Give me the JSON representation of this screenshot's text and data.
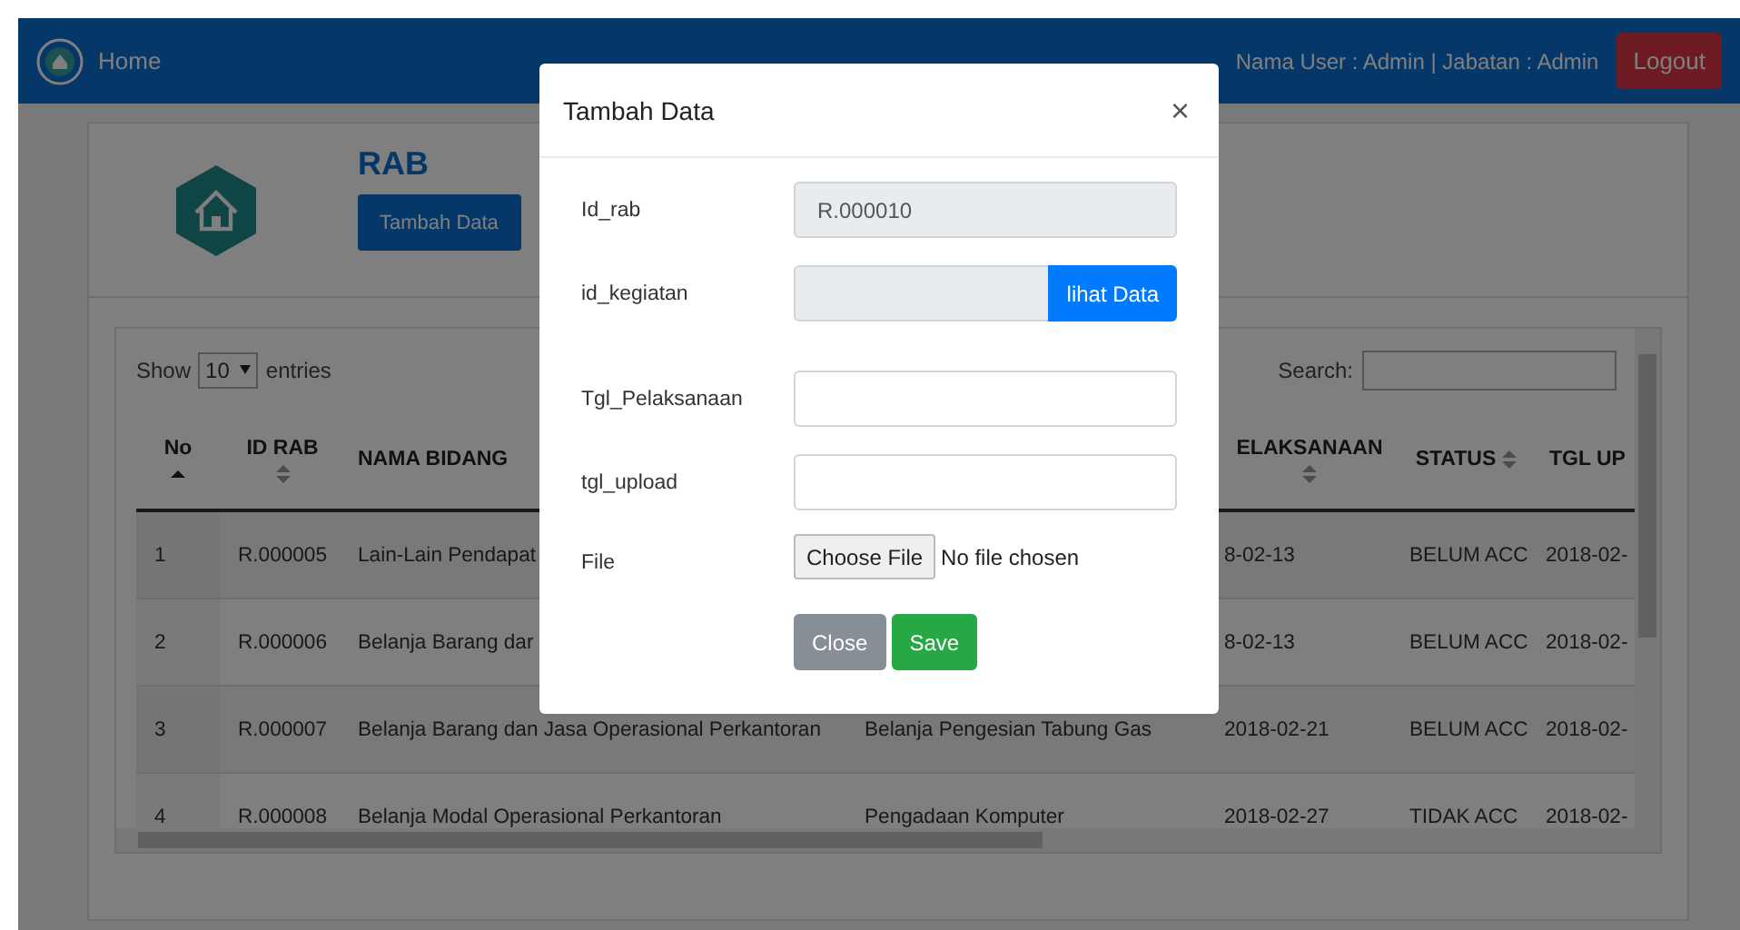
{
  "navbar": {
    "brand": "Home",
    "user_info": "Nama User : Admin | Jabatan : Admin",
    "logout": "Logout"
  },
  "header": {
    "title": "RAB",
    "add_button": "Tambah Data"
  },
  "table": {
    "length": {
      "show": "Show",
      "value": "10",
      "entries": "entries"
    },
    "search_label": "Search:",
    "columns": [
      {
        "label": "No",
        "sortable": true,
        "sorted": true
      },
      {
        "label": "ID RAB",
        "sortable": true,
        "sorted": false
      },
      {
        "label": "NAMA BIDANG",
        "sortable": false
      },
      {},
      {
        "label": "ELAKSANAAN",
        "sortable": true,
        "sorted": false
      },
      {
        "label": "STATUS",
        "sortable": true,
        "sorted": false
      },
      {
        "label": "TGL UP",
        "sortable": false
      }
    ],
    "rows": [
      [
        "1",
        "R.000005",
        "Lain-Lain Pendapat",
        null,
        "8-02-13",
        "BELUM ACC",
        "2018-02-"
      ],
      [
        "2",
        "R.000006",
        "Belanja Barang dar",
        null,
        "8-02-13",
        "BELUM ACC",
        "2018-02-"
      ],
      [
        "3",
        "R.000007",
        "Belanja Barang dan Jasa Operasional Perkantoran",
        "Belanja Pengesian Tabung Gas",
        "2018-02-21",
        "BELUM ACC",
        "2018-02-"
      ],
      [
        "4",
        "R.000008",
        "Belanja Modal Operasional Perkantoran",
        "Pengadaan Komputer",
        "2018-02-27",
        "TIDAK ACC",
        "2018-02-"
      ]
    ]
  },
  "modal": {
    "title": "Tambah Data",
    "close": "×",
    "fields": [
      {
        "kind": "readonly",
        "label": "Id_rab",
        "value": "R.000010"
      },
      {
        "kind": "lookup",
        "label": "id_kegiatan",
        "button": "lihat Data"
      },
      {
        "kind": "text",
        "label": "Tgl_Pelaksanaan"
      },
      {
        "kind": "text",
        "label": "tgl_upload"
      },
      {
        "kind": "file",
        "label": "File",
        "button": "Choose File",
        "status": "No file chosen"
      }
    ],
    "buttons": [
      {
        "kind": "secondary",
        "label": "Close"
      },
      {
        "kind": "success",
        "label": "Save"
      }
    ]
  }
}
